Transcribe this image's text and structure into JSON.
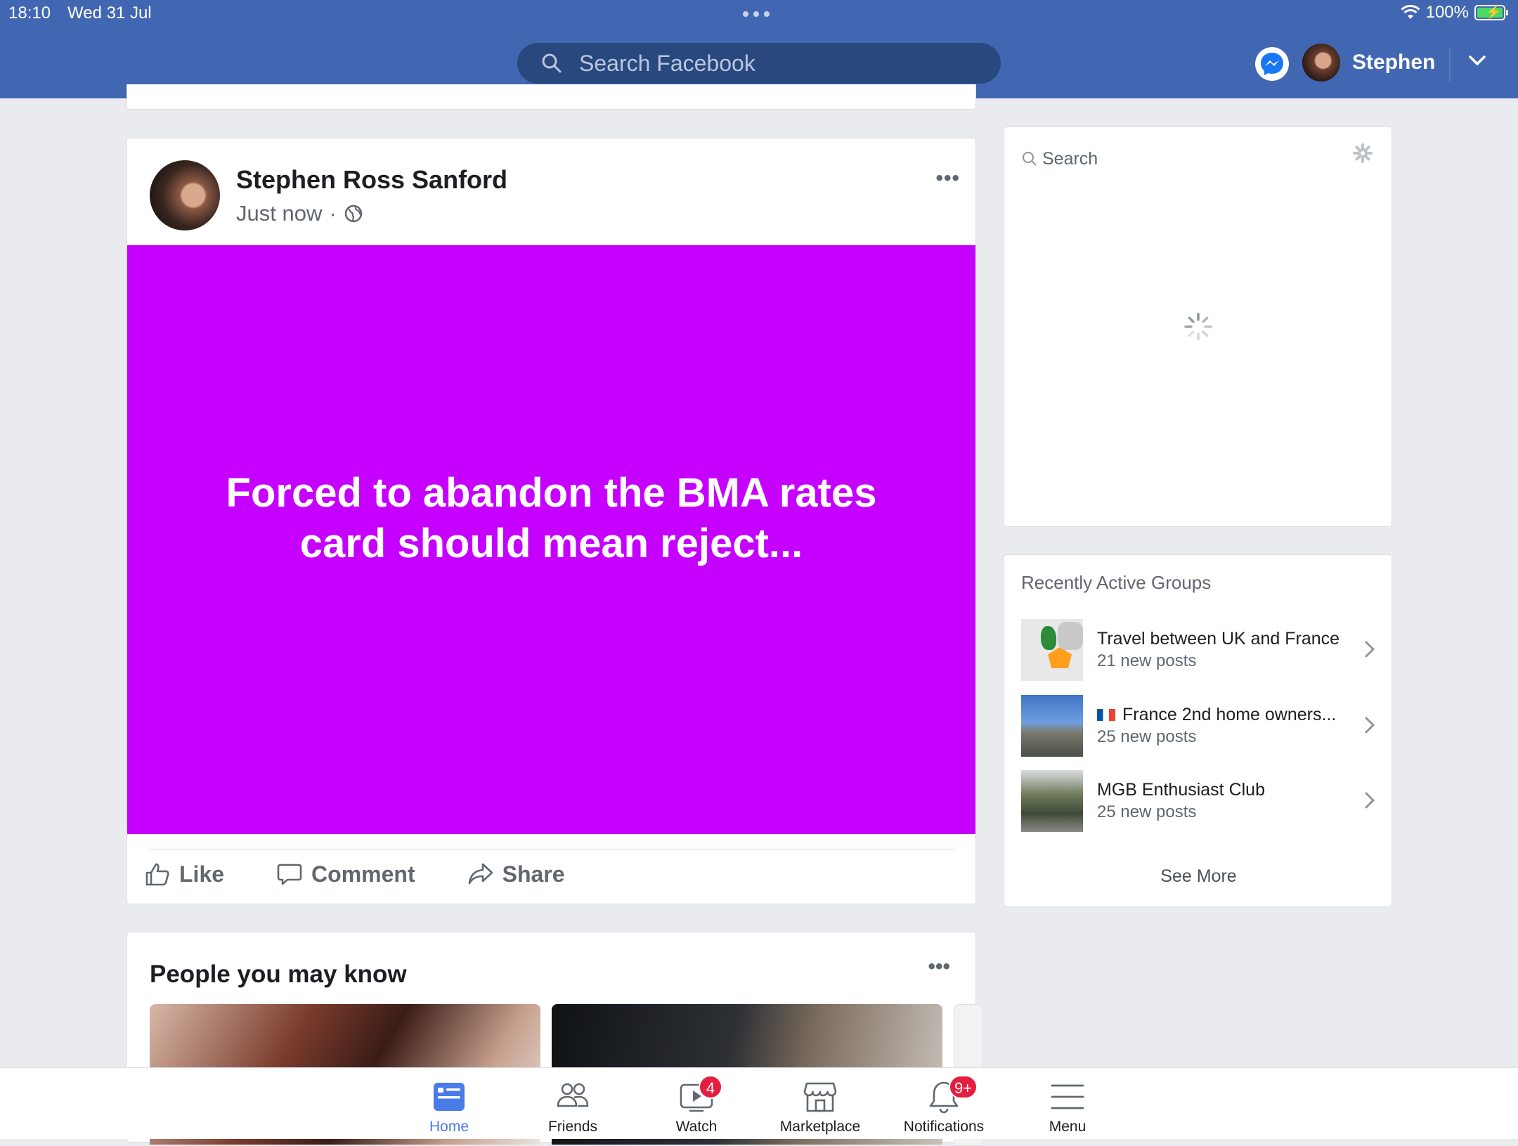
{
  "status": {
    "time": "18:10",
    "date": "Wed 31 Jul",
    "battery": "100%"
  },
  "header": {
    "search_placeholder": "Search Facebook",
    "username": "Stephen"
  },
  "post": {
    "author": "Stephen Ross Sanford",
    "time": "Just now",
    "privacy": "Public",
    "text": "Forced to abandon the BMA rates card should mean reject...",
    "background_color": "#c600ff",
    "actions": {
      "like": "Like",
      "comment": "Comment",
      "share": "Share"
    }
  },
  "pymk": {
    "title": "People you may know"
  },
  "sidebar": {
    "search_placeholder": "Search",
    "groups_title": "Recently Active Groups",
    "groups": [
      {
        "name": "Travel between UK and France",
        "sub": "21 new posts"
      },
      {
        "name": "France 2nd home owners...",
        "sub": "25 new posts"
      },
      {
        "name": "MGB Enthusiast Club",
        "sub": "25 new posts"
      }
    ],
    "see_more": "See More"
  },
  "tabs": [
    {
      "label": "Home",
      "active": true,
      "icon": "home-icon"
    },
    {
      "label": "Friends",
      "icon": "friends-icon"
    },
    {
      "label": "Watch",
      "badge": "4",
      "icon": "watch-icon"
    },
    {
      "label": "Marketplace",
      "icon": "marketplace-icon"
    },
    {
      "label": "Notifications",
      "badge": "9+",
      "icon": "bell-icon"
    },
    {
      "label": "Menu",
      "icon": "menu-icon"
    }
  ],
  "colors": {
    "brand": "#4267b2",
    "accent": "#4a7ce8",
    "badge": "#e41e3f"
  }
}
